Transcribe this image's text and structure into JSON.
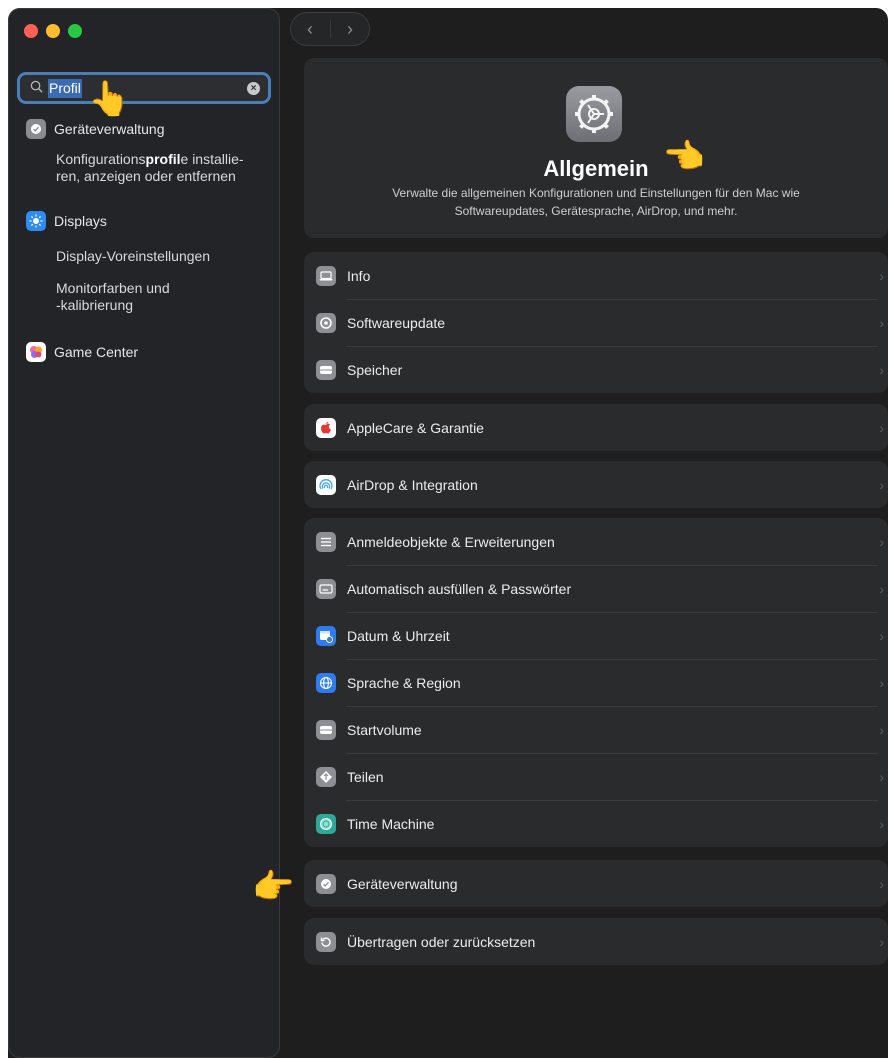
{
  "sidebar": {
    "search": {
      "query": "Profil",
      "clear_icon": "clear-icon"
    },
    "results": [
      {
        "label": "Geräteverwaltung",
        "icon": "device-management-icon",
        "color": "#8a8b90"
      },
      {
        "sub_pre": "Konfigurations",
        "sub_bold": "profil",
        "sub_post": "e installie-\nren, anzeigen oder entfernen"
      },
      {
        "label": "Displays",
        "icon": "displays-icon",
        "color": "#2f8cf0"
      },
      {
        "sub": "Display-Voreinstellungen"
      },
      {
        "sub": "Monitorfarben und\n-kalibrierung"
      },
      {
        "label": "Game Center",
        "icon": "game-center-icon"
      }
    ]
  },
  "nav": {
    "back_icon": "chevron-left-icon",
    "forward_icon": "chevron-right-icon"
  },
  "header": {
    "title": "Allgemein",
    "description": "Verwalte die allgemeinen Konfigurationen und Einstellungen für den Mac wie Softwareupdates, Gerätesprache, AirDrop, und mehr."
  },
  "groups": [
    {
      "items": [
        {
          "label": "Info",
          "icon": "laptop-icon",
          "color": "#8e8f94"
        },
        {
          "label": "Softwareupdate",
          "icon": "gear-badge-icon",
          "color": "#8e8f94"
        },
        {
          "label": "Speicher",
          "icon": "storage-icon",
          "color": "#8e8f94"
        }
      ]
    },
    {
      "items": [
        {
          "label": "AppleCare & Garantie",
          "icon": "apple-icon",
          "color": "#e53935"
        }
      ]
    },
    {
      "items": [
        {
          "label": "AirDrop & Integration",
          "icon": "airdrop-icon",
          "color": "#3fa9f5"
        }
      ]
    },
    {
      "items": [
        {
          "label": "Anmeldeobjekte & Erweiterungen",
          "icon": "list-icon",
          "color": "#8e8f94"
        },
        {
          "label": "Automatisch ausfüllen & Passwörter",
          "icon": "autofill-icon",
          "color": "#8e8f94"
        },
        {
          "label": "Datum & Uhrzeit",
          "icon": "calendar-clock-icon",
          "color": "#2f7cf0"
        },
        {
          "label": "Sprache & Region",
          "icon": "globe-icon",
          "color": "#2f7cf0"
        },
        {
          "label": "Startvolume",
          "icon": "disk-icon",
          "color": "#8e8f94"
        },
        {
          "label": "Teilen",
          "icon": "share-icon",
          "color": "#8e8f94"
        },
        {
          "label": "Time Machine",
          "icon": "time-machine-icon",
          "color": "#2fa89a"
        }
      ]
    },
    {
      "items": [
        {
          "label": "Geräteverwaltung",
          "icon": "device-management-icon",
          "color": "#8e8f94"
        }
      ]
    },
    {
      "items": [
        {
          "label": "Übertragen oder zurücksetzen",
          "icon": "reset-icon",
          "color": "#8e8f94"
        }
      ]
    }
  ]
}
